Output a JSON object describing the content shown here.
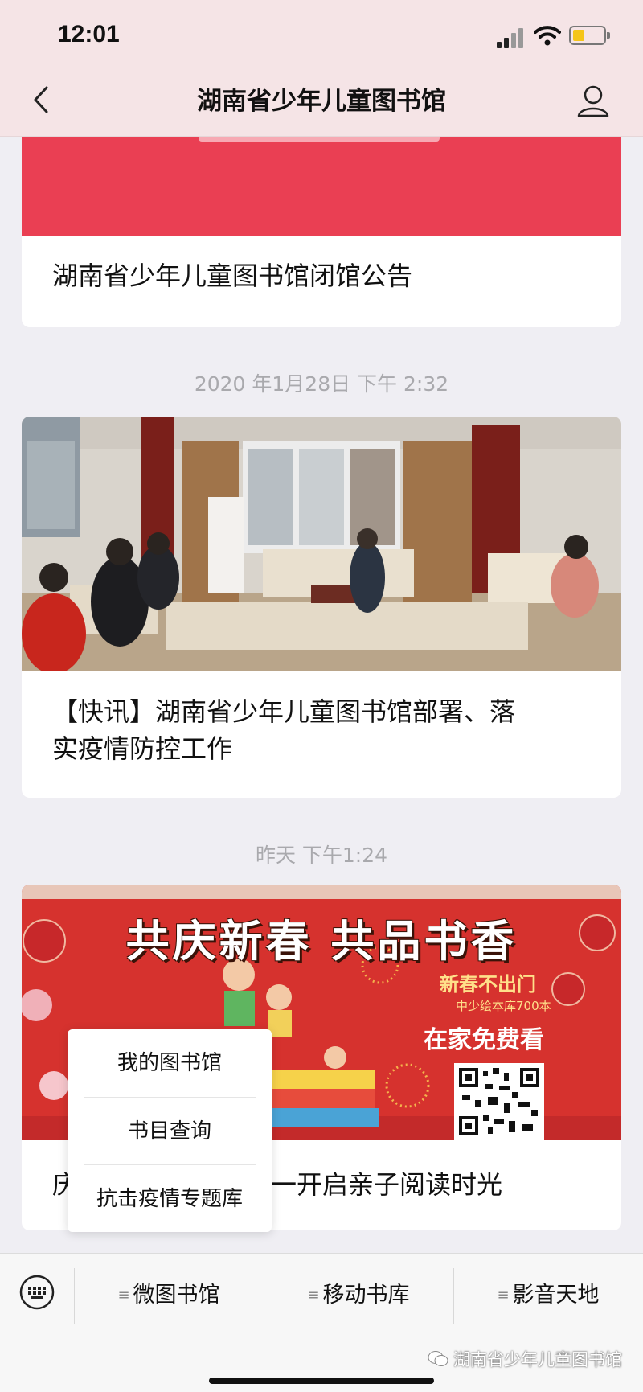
{
  "status_bar": {
    "time": "12:01"
  },
  "header": {
    "title": "湖南省少年儿童图书馆"
  },
  "feed": [
    {
      "title": "湖南省少年儿童图书馆闭馆公告"
    },
    {
      "timestamp": "2020 年1月28日 下午 2:32",
      "title_line1": "【快讯】湖南省少年儿童图书馆部署、落",
      "title_line2": "实疫情防控工作"
    },
    {
      "timestamp": "昨天 下午1:24",
      "poster": {
        "headline": "共庆新春 共品书香",
        "sub1": "新春不出门",
        "sub2": "中少绘本库700本",
        "sub3": "在家免费看"
      },
      "title_left": "庆",
      "title_right": "一开启亲子阅读时光"
    }
  ],
  "popup_menu": {
    "items": [
      "我的图书馆",
      "书目查询",
      "抗击疫情专题库"
    ]
  },
  "bottom_menu": {
    "items": [
      "微图书馆",
      "移动书库",
      "影音天地"
    ]
  },
  "watermark": "湖南省少年儿童图书馆",
  "colors": {
    "accent_red": "#ea3f53",
    "header_bg": "#f5e4e6",
    "battery": "#f5c518"
  }
}
